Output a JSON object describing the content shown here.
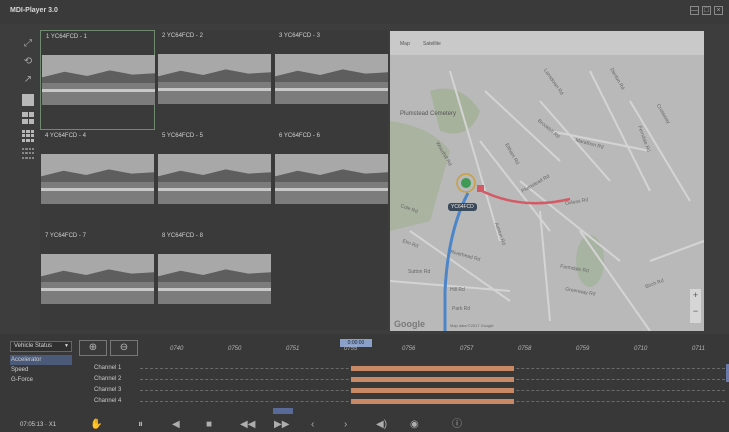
{
  "app": {
    "title": "MDI-Player 3.0",
    "window_controls": [
      "—",
      "□",
      "×"
    ]
  },
  "toolbar": {
    "icons": [
      "expand-icon",
      "rotate-icon",
      "share-icon",
      "layout-1-icon",
      "layout-4-icon",
      "layout-9-icon",
      "layout-16-icon"
    ]
  },
  "cameras": [
    {
      "label": "1 YC64FCD - 1"
    },
    {
      "label": "2 YC64FCD - 2"
    },
    {
      "label": "3 YC64FCD - 3"
    },
    {
      "label": "4 YC64FCD - 4"
    },
    {
      "label": "5 YC64FCD - 5"
    },
    {
      "label": "6 YC64FCD - 6"
    },
    {
      "label": "7 YC64FCD - 7"
    },
    {
      "label": "8 YC64FCD - 8"
    }
  ],
  "map": {
    "tabs": [
      "Map",
      "Satellite"
    ],
    "cemetery_label": "Plumstead Cemetery",
    "vehicle_tag": "YC64FCD",
    "attribution": "Map data ©2017 Google",
    "streets": [
      "Lansdown Rd",
      "Denton Rd",
      "Crossway",
      "Brookhill Rd",
      "Marathon Rd",
      "Ferndale Rd",
      "Eltham Rd",
      "Plumstead Rd",
      "Oxleas Rd",
      "Woodhill Rd",
      "Cole Rd",
      "Elm Rd",
      "Sutton Rd",
      "Ashton Rd",
      "Riverhead Rd",
      "Farmdale Rd",
      "Greenway Rd",
      "Hill Rd",
      "Park Rd",
      "Birch Rd"
    ],
    "google_logo": "Google",
    "zoom_in": "+",
    "zoom_out": "−"
  },
  "timeline": {
    "dropdown_value": "Vehicle Status",
    "metrics": [
      "Accelerator",
      "Speed",
      "G-Force"
    ],
    "cursor_label": "0:00:00",
    "ticks": [
      "0740",
      "0750",
      "0751",
      "0755",
      "0756",
      "0757",
      "0758",
      "0759",
      "0710",
      "0711"
    ],
    "channels": [
      "Channel 1",
      "Channel 2",
      "Channel 3",
      "Channel 4"
    ],
    "recording_segment": {
      "start_fraction": 0.36,
      "end_fraction": 0.64
    },
    "playhead_fraction": 0.245
  },
  "playback": {
    "time_readout": "07:05:13 · X1",
    "controls": [
      "hand-icon",
      "pause-icon",
      "step-back-icon",
      "stop-icon",
      "rewind-icon",
      "fast-forward-icon",
      "prev-icon",
      "next-icon",
      "volume-icon",
      "camera-icon",
      "info-icon"
    ]
  },
  "colors": {
    "route_blue": "#4d86c8",
    "route_red": "#d45a66",
    "recording_segment": "#c88a66",
    "selection_blue": "#4a5a78"
  }
}
